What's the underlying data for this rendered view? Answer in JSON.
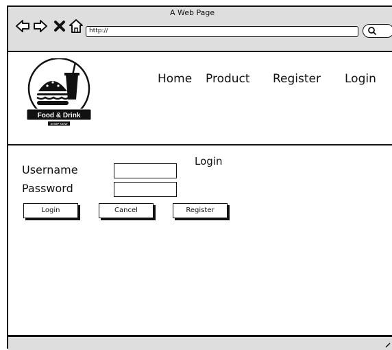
{
  "browser": {
    "page_title": "A Web Page",
    "url": "http://"
  },
  "logo": {
    "name": "Food & Drink",
    "tagline": "SHOP NOW"
  },
  "nav": {
    "home": "Home",
    "product": "Product",
    "register": "Register",
    "login": "Login"
  },
  "form": {
    "heading": "Login",
    "username_label": "Username",
    "password_label": "Password",
    "username_value": "",
    "password_value": "",
    "login_button": "Login",
    "cancel_button": "Cancel",
    "register_button": "Register"
  },
  "icons": {
    "back": "back-arrow-icon",
    "forward": "forward-arrow-icon",
    "stop": "close-icon",
    "home": "home-icon",
    "search": "search-icon"
  }
}
